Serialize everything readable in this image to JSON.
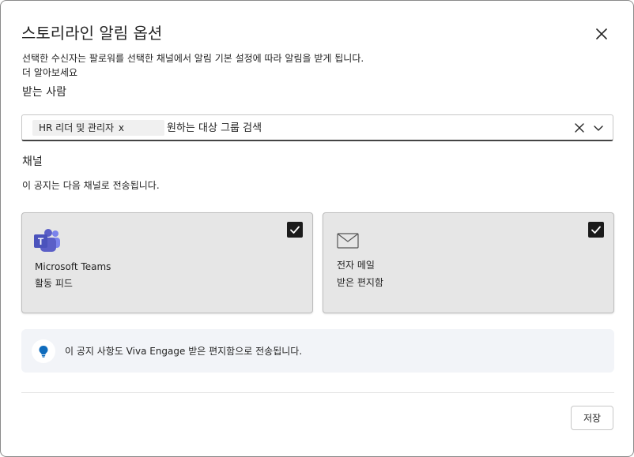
{
  "dialog": {
    "title": "스토리라인 알림 옵션",
    "close_icon": "close-icon",
    "description_text": "선택한 수신자는 팔로워를 선택한 채널에서 알림 기본 설정에 따라 알림을 받게 됩니다.",
    "learn_more_link": "더 알아보세요"
  },
  "recipients": {
    "label": "받는 사람",
    "chip_label": "HR 리더 및 관리자",
    "chip_remove": "x",
    "search_placeholder": "원하는 대상 그룹 검색",
    "clear_icon": "clear-icon",
    "dropdown_icon": "chevron-down-icon"
  },
  "channels": {
    "heading": "채널",
    "description": "이 공지는 다음 채널로 전송됩니다.",
    "items": [
      {
        "name": "Microsoft Teams",
        "sub": "활동 피드",
        "icon": "teams-icon",
        "checked": true
      },
      {
        "name": "전자 메일",
        "sub": "받은 편지함",
        "icon": "mail-icon",
        "checked": true
      }
    ]
  },
  "info_banner": {
    "icon": "lightbulb-icon",
    "text": "이 공지 사항도 Viva Engage 받은 편지함으로 전송됩니다."
  },
  "footer": {
    "save_label": "저장"
  },
  "colors": {
    "teams_purple": "#5b5fc7",
    "bulb_blue": "#0f6cbd",
    "card_bg": "#e6e6e6",
    "banner_bg": "#f2f4f8",
    "checkbox_bg": "#1b1b1b"
  }
}
